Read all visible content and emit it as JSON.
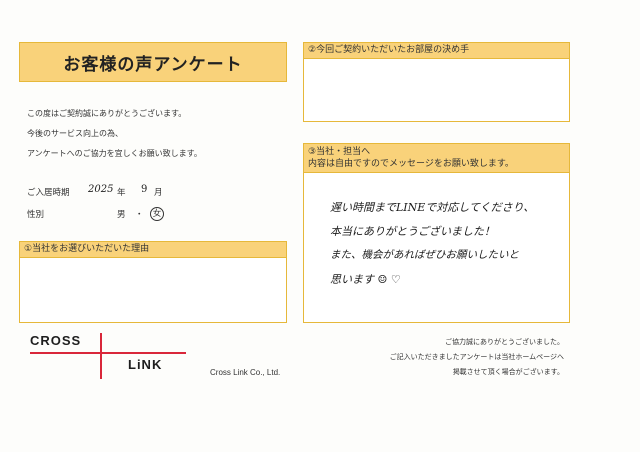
{
  "title": "お客様の声アンケート",
  "intro_lines": [
    "この度はご契約誠にありがとうございます。",
    "今後のサービス向上の為、",
    "アンケートへのご協力を宜しくお願い致します。"
  ],
  "move_in": {
    "label": "ご入居時期",
    "year": "2025",
    "year_unit": "年",
    "month": "9",
    "month_unit": "月"
  },
  "gender": {
    "label": "性別",
    "male": "男",
    "separator": "・",
    "female": "女",
    "selected": "女"
  },
  "section1": {
    "heading": "①当社をお選びいただいた理由",
    "answer": ""
  },
  "section2": {
    "heading": "②今回ご契約いただいたお部屋の決め手",
    "answer": ""
  },
  "section3": {
    "heading_line1": "③当社・担当へ",
    "heading_line2": "内容は自由ですのでメッセージをお願い致します。",
    "message_lines": [
      "遅い時間までLINEで対応してくださり、",
      "本当にありがとうございました！",
      "また、機会があればぜひお願いしたいと",
      "思います ☺ ♡"
    ]
  },
  "logo": {
    "top": "CROSS",
    "bottom": "LiNK",
    "line_color": "#d9273a"
  },
  "company": "Cross Link Co., Ltd.",
  "footer_lines": [
    "ご協力誠にありがとうございました。",
    "ご記入いただきましたアンケートは当社ホームページへ",
    "掲載させて頂く場合がございます。"
  ],
  "colors": {
    "accent": "#f9d27a",
    "border": "#e6b83a"
  }
}
